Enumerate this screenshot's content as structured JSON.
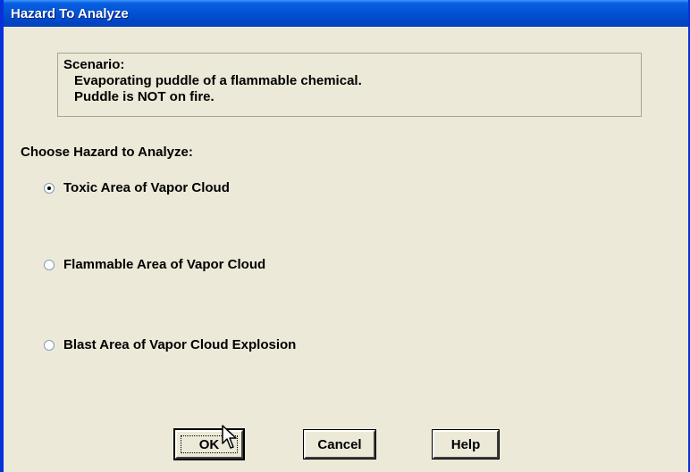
{
  "window": {
    "title": "Hazard To Analyze"
  },
  "scenario": {
    "heading": "Scenario:",
    "line1": "Evaporating puddle of a flammable chemical.",
    "line2": "Puddle is NOT on fire."
  },
  "choose_label": "Choose Hazard to Analyze:",
  "options": [
    {
      "label": "Toxic Area of Vapor Cloud",
      "selected": true
    },
    {
      "label": "Flammable Area of Vapor Cloud",
      "selected": false
    },
    {
      "label": "Blast Area of Vapor Cloud Explosion",
      "selected": false
    }
  ],
  "buttons": {
    "ok": "OK",
    "cancel": "Cancel",
    "help": "Help"
  },
  "icons": {
    "pointer": "mouse-pointer-icon"
  },
  "colors": {
    "titlebar": "#0253d6",
    "dialog_bg": "#ece9d8",
    "title_text": "#ffffff"
  }
}
